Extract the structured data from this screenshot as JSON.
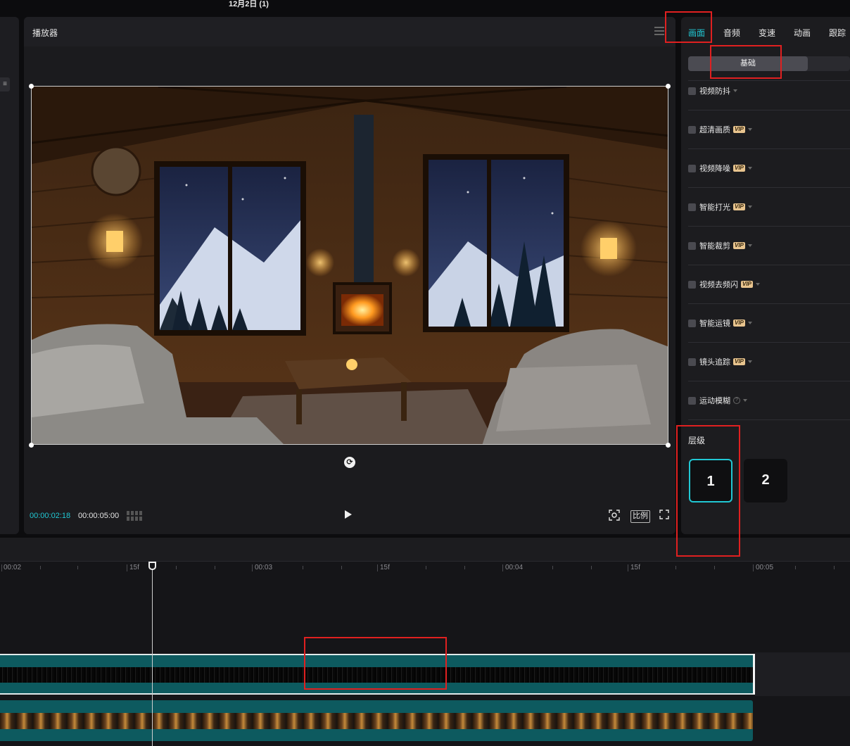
{
  "window": {
    "title": "12月2日 (1)"
  },
  "player": {
    "title": "播放器",
    "current_time": "00:00:02:18",
    "total_time": "00:00:05:00",
    "ratio_label": "比例"
  },
  "inspector": {
    "tabs": [
      "画面",
      "音频",
      "变速",
      "动画",
      "跟踪"
    ],
    "active_tab": "画面",
    "subtab": "基础",
    "features": [
      {
        "label": "视频防抖",
        "vip": false,
        "help": false
      },
      {
        "label": "超清画质",
        "vip": true,
        "help": false
      },
      {
        "label": "视频降噪",
        "vip": true,
        "help": false
      },
      {
        "label": "智能打光",
        "vip": true,
        "help": false
      },
      {
        "label": "智能裁剪",
        "vip": true,
        "help": false
      },
      {
        "label": "视频去频闪",
        "vip": true,
        "help": false
      },
      {
        "label": "智能运镜",
        "vip": true,
        "help": false
      },
      {
        "label": "镜头追踪",
        "vip": true,
        "help": false
      },
      {
        "label": "运动模糊",
        "vip": false,
        "help": true
      }
    ],
    "vip_badge": "VIP",
    "layer": {
      "title": "层级",
      "options": [
        "1",
        "2"
      ],
      "selected": "1"
    }
  },
  "timeline": {
    "ruler_labels": [
      "00:02",
      "15f",
      "00:03",
      "15f",
      "00:04",
      "15f",
      "00:05"
    ]
  },
  "colors": {
    "accent": "#21c8d4",
    "track": "#0d5a5f",
    "annotation": "#e02020",
    "vip": "#e8c48e"
  }
}
